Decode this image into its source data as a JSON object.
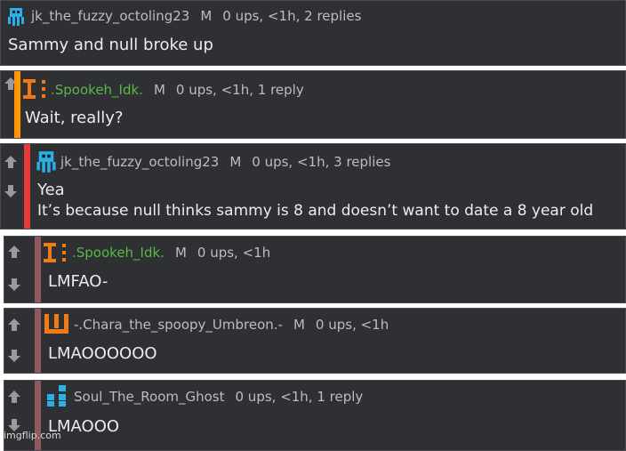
{
  "colors": {
    "background": "#2f3033",
    "meta_text": "#bdbdbd",
    "green_username": "#58b947",
    "orange_bar": "#ff9500",
    "red_bar": "#e8393b",
    "muted_bar": "#8f5a5c",
    "squid_icon": "#29b0e6",
    "orange_icon": "#f07a14"
  },
  "comments": [
    {
      "icon": "blue-squid-icon",
      "username": "jk_the_fuzzy_octoling23",
      "mod": "M",
      "stats": "0 ups, <1h, 2 replies",
      "lines": [
        "Sammy and null broke up"
      ]
    },
    {
      "icon": "orange-tower-icon",
      "username": ".Spookeh_Idk.",
      "mod": "M",
      "stats": "0 ups, <1h, 1 reply",
      "lines": [
        "Wait, really?"
      ]
    },
    {
      "icon": "blue-squid-icon",
      "username": "jk_the_fuzzy_octoling23",
      "mod": "M",
      "stats": "0 ups, <1h, 3 replies",
      "lines": [
        "Yea",
        "It’s because null thinks sammy is 8 and doesn’t want to date a 8 year old"
      ]
    },
    {
      "icon": "orange-tower-icon",
      "username": ".Spookeh_Idk.",
      "mod": "M",
      "stats": "0 ups, <1h",
      "lines": [
        "LMFAO-"
      ]
    },
    {
      "icon": "orange-fork-icon",
      "username": "-.Chara_the_spoopy_Umbreon.-",
      "mod": "M",
      "stats": "0 ups, <1h",
      "lines": [
        "LMAOOOOOO"
      ]
    },
    {
      "icon": "blue-blocks-icon",
      "username": "Soul_The_Room_Ghost",
      "mod": "",
      "stats": "0 ups, <1h, 1 reply",
      "lines": [
        "LMAOOO"
      ]
    }
  ],
  "watermark": "imgflip.com"
}
